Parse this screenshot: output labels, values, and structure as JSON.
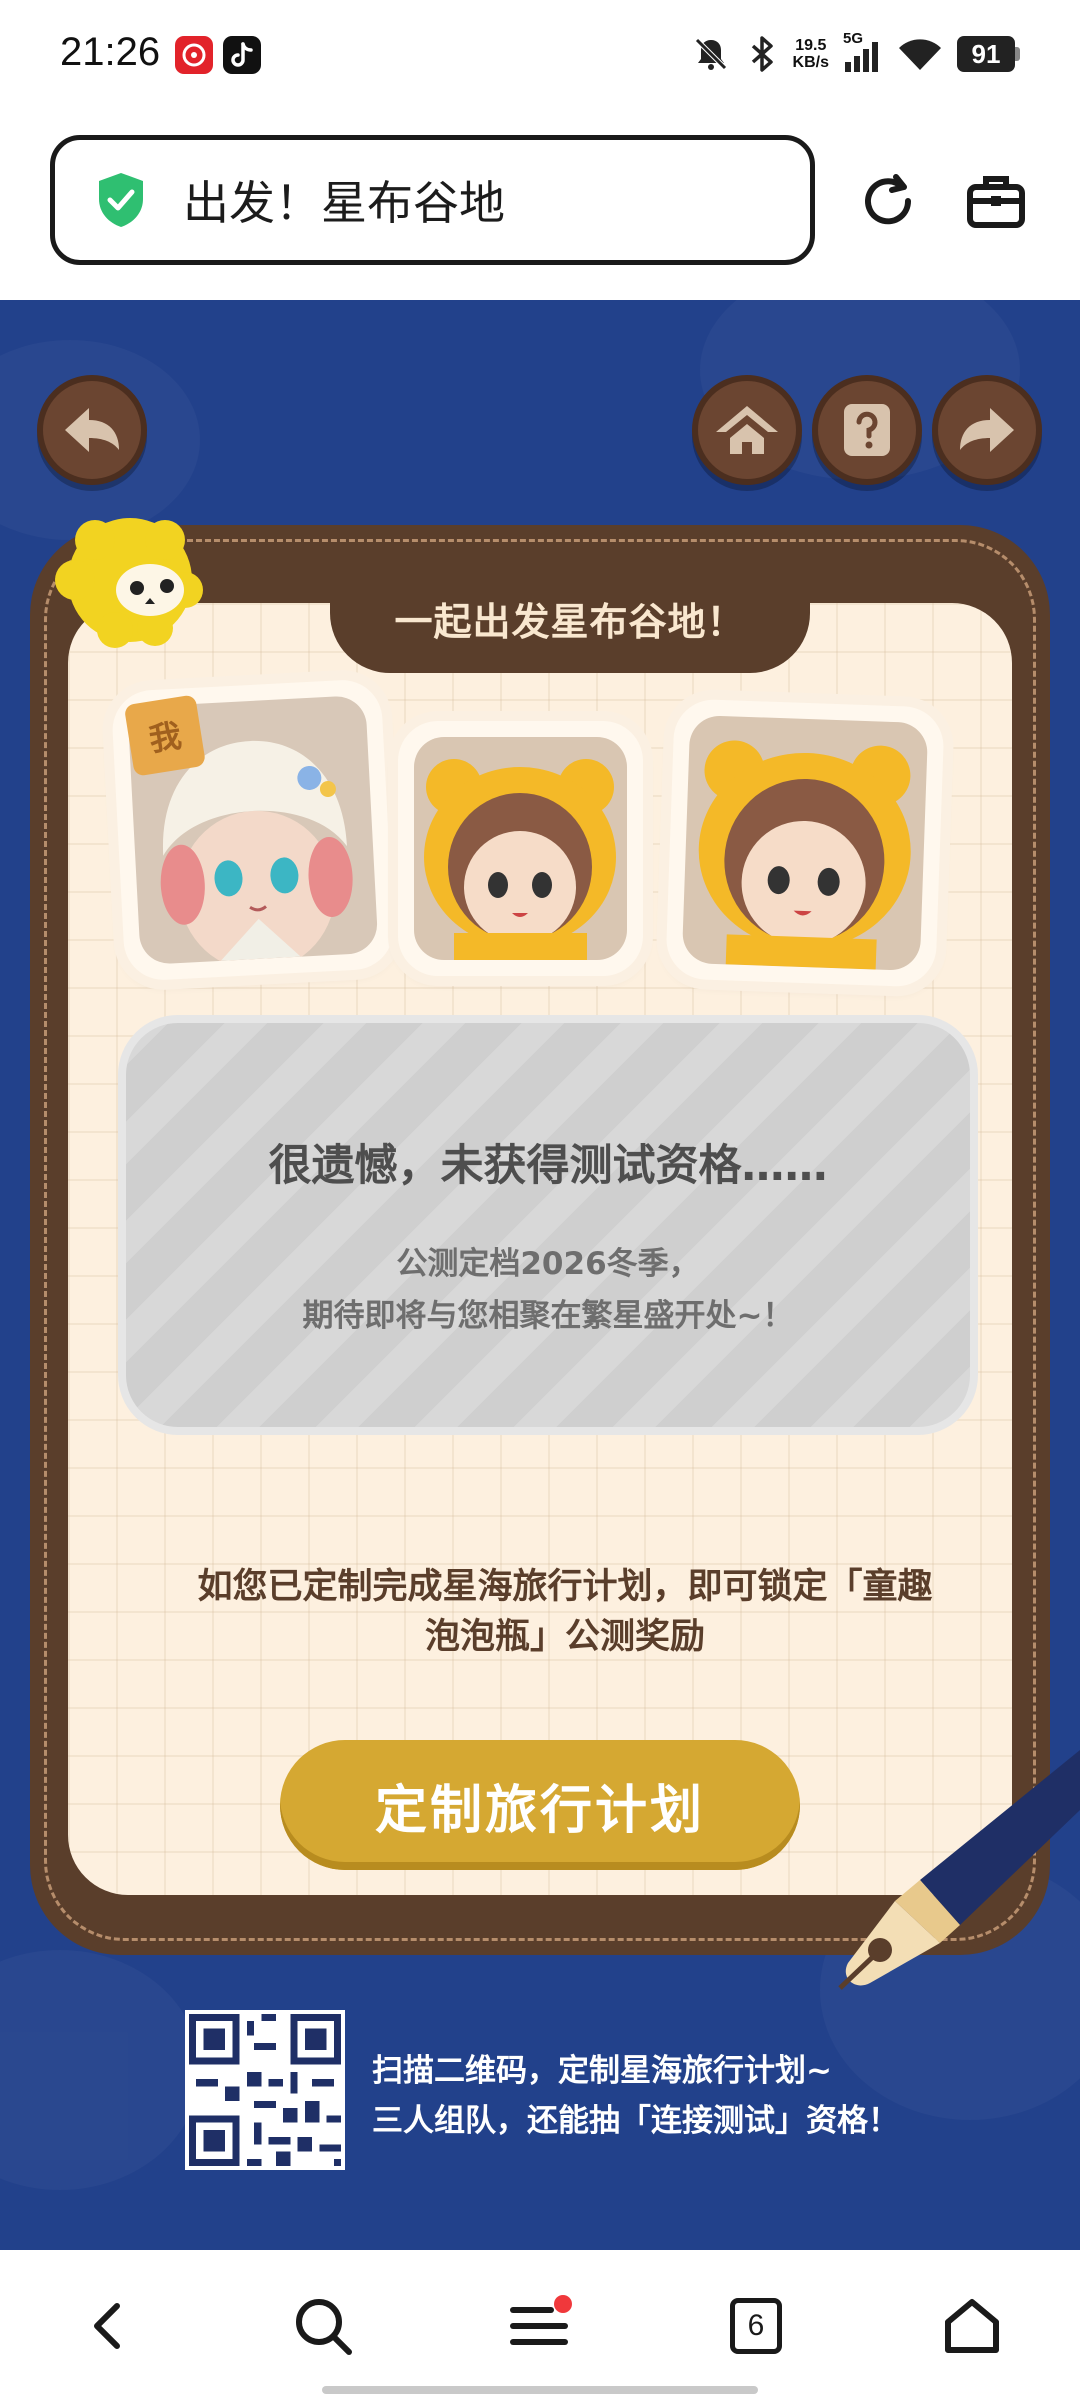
{
  "status_bar": {
    "time": "21:26",
    "net_speed_value": "19.5",
    "net_speed_unit": "KB/s",
    "signal_label": "5G",
    "battery": "91",
    "icons": [
      "netease-music-icon",
      "tiktok-icon",
      "mute-icon",
      "bluetooth-icon",
      "signal-icon",
      "wifi-icon",
      "battery-icon"
    ]
  },
  "browser": {
    "page_title": "出发！星布谷地",
    "icons": [
      "shield-check-icon",
      "refresh-icon",
      "toolbox-icon"
    ]
  },
  "page": {
    "card_title": "一起出发星布谷地！",
    "me_badge": "我",
    "result_heading": "很遗憾，未获得测试资格……",
    "result_sub_1": "公测定档2026冬季，",
    "result_sub_2": "期待即将与您相聚在繁星盛开处~！",
    "info_text": "如您已定制完成星海旅行计划，即可锁定「童趣泡泡瓶」公测奖励",
    "cta_label": "定制旅行计划",
    "qr_line_1": "扫描二维码，定制星海旅行计划~",
    "qr_line_2": "三人组队，还能抽「连接测试」资格！",
    "colors": {
      "background": "#22418b",
      "frame": "#5a3e2b",
      "card": "#fdf0df",
      "cta": "#d5a832"
    }
  },
  "nav_bar": {
    "tab_count": "6",
    "icons": [
      "back-icon",
      "search-icon",
      "menu-icon",
      "tabs-icon",
      "home-icon"
    ]
  }
}
